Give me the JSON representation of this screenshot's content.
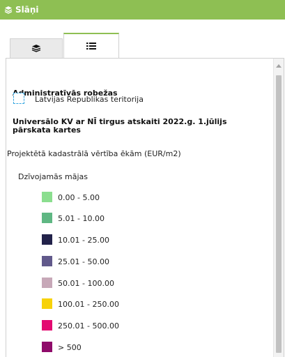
{
  "header": {
    "title": "Slāņi",
    "icon": "layers-icon"
  },
  "tabs": [
    {
      "name": "layers",
      "icon": "layers-icon",
      "active": false
    },
    {
      "name": "legend",
      "icon": "list-icon",
      "active": true
    }
  ],
  "legend": {
    "admin_title": "Administratīvās robežas",
    "territory_label": "Latvijas Republikas teritorija",
    "report_title_line1": "Universālo KV ar NĪ tirgus atskaiti 2022.g. 1.jūlijs",
    "report_title_line2": "pārskata kartes",
    "projected_value_label": "Projektētā kadastrālā vērtība ēkām (EUR/m2)",
    "building_type_label": "Dzīvojamās mājas",
    "classes": [
      {
        "label": "0.00 - 5.00",
        "color": "#8bde8f"
      },
      {
        "label": "5.01 - 10.00",
        "color": "#5fb783"
      },
      {
        "label": "10.01 - 25.00",
        "color": "#22224a"
      },
      {
        "label": "25.01 - 50.00",
        "color": "#61598b"
      },
      {
        "label": "50.01 - 100.00",
        "color": "#c7a8b8"
      },
      {
        "label": "100.01 - 250.00",
        "color": "#f7d20a"
      },
      {
        "label": "250.01 - 500.00",
        "color": "#e30a71"
      },
      {
        "label": "> 500",
        "color": "#8f0b6a"
      }
    ]
  },
  "colors": {
    "header_bg": "#8ebf53",
    "active_tab_border": "#8ebf53"
  }
}
